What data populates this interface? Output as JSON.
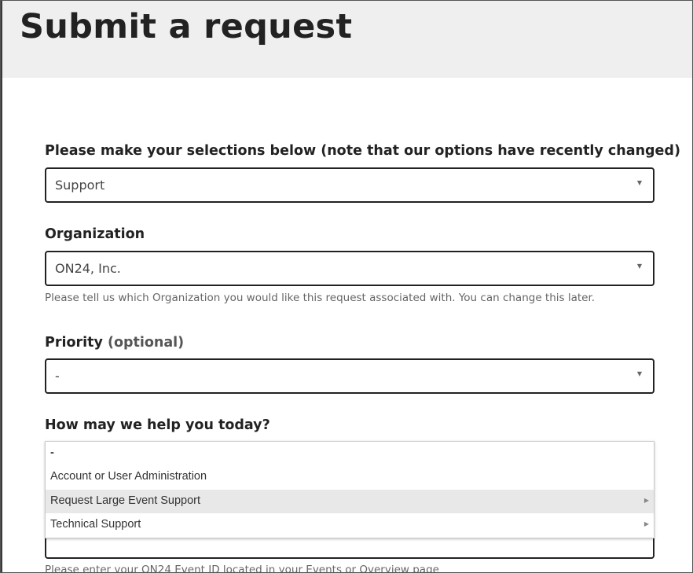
{
  "header": {
    "title": "Submit a request"
  },
  "form": {
    "selection": {
      "label": "Please make your selections below (note that our options have recently changed)",
      "value": "Support"
    },
    "organization": {
      "label": "Organization",
      "value": "ON24, Inc.",
      "hint": "Please tell us which Organization you would like this request associated with. You can change this later."
    },
    "priority": {
      "label": "Priority",
      "optional": "(optional)",
      "value": "-"
    },
    "help": {
      "label": "How may we help you today?",
      "options": [
        {
          "label": "-",
          "has_submenu": false,
          "highlighted": false
        },
        {
          "label": "Account or User Administration",
          "has_submenu": false,
          "highlighted": false
        },
        {
          "label": "Request Large Event Support",
          "has_submenu": true,
          "highlighted": true
        },
        {
          "label": "Technical Support",
          "has_submenu": true,
          "highlighted": false
        }
      ]
    },
    "event_id": {
      "hint": "Please enter your ON24 Event ID located in your Events or Overview page"
    }
  },
  "icons": {
    "dropdown_caret": "caret-down-icon",
    "submenu_arrow": "caret-right-icon"
  },
  "colors": {
    "header_bg": "#efefef",
    "border": "#222222",
    "highlight": "#e8e8e8"
  }
}
